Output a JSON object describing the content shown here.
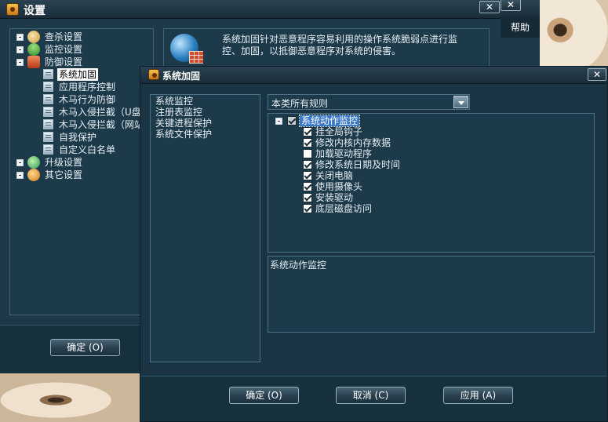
{
  "settings_window": {
    "title": "设置",
    "close_glyph": "✕",
    "help_label": "帮助",
    "info_text": "系统加固针对恶意程序容易利用的操作系统脆弱点进行监控、加固，以抵御恶意程序对系统的侵害。",
    "tree": [
      {
        "label": "查杀设置",
        "icon": "scan-icon"
      },
      {
        "label": "监控设置",
        "icon": "umbrella-icon"
      },
      {
        "label": "防御设置",
        "icon": "shield-icon"
      },
      {
        "label": "系统加固",
        "icon": "list-icon",
        "selected": true
      },
      {
        "label": "应用程序控制",
        "icon": "list-icon"
      },
      {
        "label": "木马行为防御",
        "icon": "list-icon"
      },
      {
        "label": "木马入侵拦截（U盘",
        "icon": "list-icon"
      },
      {
        "label": "木马入侵拦截（网站",
        "icon": "list-icon"
      },
      {
        "label": "自我保护",
        "icon": "list-icon"
      },
      {
        "label": "自定义白名单",
        "icon": "list-icon"
      },
      {
        "label": "升级设置",
        "icon": "update-icon"
      },
      {
        "label": "其它设置",
        "icon": "settings-icon"
      }
    ],
    "ok_label": "确定 (O)"
  },
  "dialog": {
    "title": "系统加固",
    "close_glyph": "✕",
    "categories": [
      "系统监控",
      "注册表监控",
      "关键进程保护",
      "系统文件保护"
    ],
    "filter_value": "本类所有规则",
    "root_rule": "系统动作监控",
    "rules": [
      {
        "label": "挂全局钩子",
        "checked": true
      },
      {
        "label": "修改内核内存数据",
        "checked": true
      },
      {
        "label": "加载驱动程序",
        "checked": false
      },
      {
        "label": "修改系统日期及时间",
        "checked": true
      },
      {
        "label": "关闭电脑",
        "checked": true
      },
      {
        "label": "使用摄像头",
        "checked": true
      },
      {
        "label": "安装驱动",
        "checked": true
      },
      {
        "label": "底层磁盘访问",
        "checked": true
      }
    ],
    "description": "系统动作监控",
    "buttons": {
      "ok": "确定 (O)",
      "cancel": "取消 (C)",
      "apply": "应用 (A)"
    }
  },
  "colors": {
    "window_bg": "#1e3a4a",
    "selection": "#3a78c8",
    "border": "#4b7087"
  }
}
